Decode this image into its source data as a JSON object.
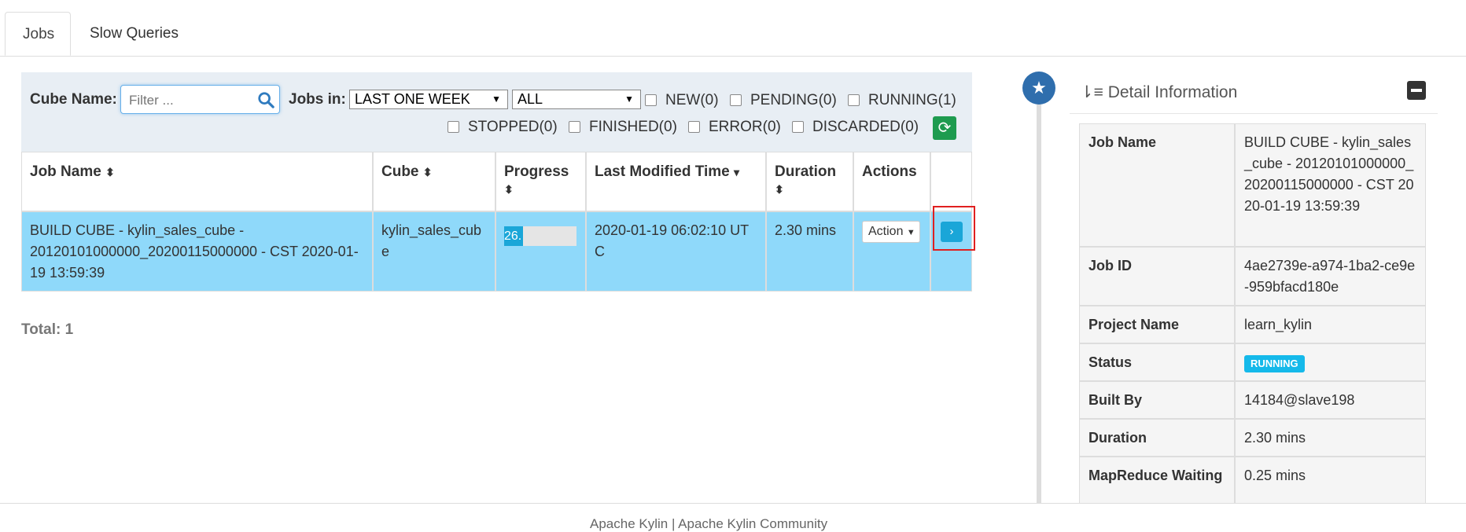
{
  "tabs": {
    "jobs": "Jobs",
    "slow_queries": "Slow Queries"
  },
  "filter": {
    "cube_name_label": "Cube Name:",
    "search_placeholder": "Filter ...",
    "jobs_in_label": "Jobs in:",
    "time_range_value": "LAST ONE WEEK",
    "scope_value": "ALL",
    "statuses": {
      "new": "NEW(0)",
      "pending": "PENDING(0)",
      "running": "RUNNING(1)",
      "stopped": "STOPPED(0)",
      "finished": "FINISHED(0)",
      "error": "ERROR(0)",
      "discarded": "DISCARDED(0)"
    }
  },
  "table": {
    "headers": {
      "job_name": "Job Name",
      "cube": "Cube",
      "progress": "Progress",
      "last_modified": "Last Modified Time",
      "duration": "Duration",
      "actions": "Actions"
    },
    "row": {
      "job_name": "BUILD CUBE - kylin_sales_cube - 20120101000000_20200115000000 - CST 2020-01-19 13:59:39",
      "cube": "kylin_sales_cube",
      "progress_label": "26.",
      "progress_fraction": 0.26,
      "last_modified": "2020-01-19 06:02:10 UTC",
      "duration": "2.30 mins",
      "action_label": "Action"
    }
  },
  "total": "Total: 1",
  "detail": {
    "title": "Detail Information",
    "rows": [
      {
        "key": "Job Name",
        "value": "BUILD CUBE - kylin_sales_cube - 20120101000000_20200115000000 - CST 2020-01-19 13:59:39"
      },
      {
        "key": "Job ID",
        "value": "4ae2739e-a974-1ba2-ce9e-959bfacd180e"
      },
      {
        "key": "Project Name",
        "value": "learn_kylin"
      },
      {
        "key": "Status",
        "value": "RUNNING"
      },
      {
        "key": "Built By",
        "value": "14184@slave198"
      },
      {
        "key": "Duration",
        "value": "2.30 mins"
      },
      {
        "key": "MapReduce Waiting",
        "value": "0.25 mins"
      }
    ]
  },
  "footer": {
    "text": "Apache Kylin | Apache Kylin Community"
  },
  "colors": {
    "row_highlight": "#8fd9fa",
    "accent": "#1aa6d8",
    "refresh": "#1e9b4f",
    "status": "#15b9ea"
  }
}
